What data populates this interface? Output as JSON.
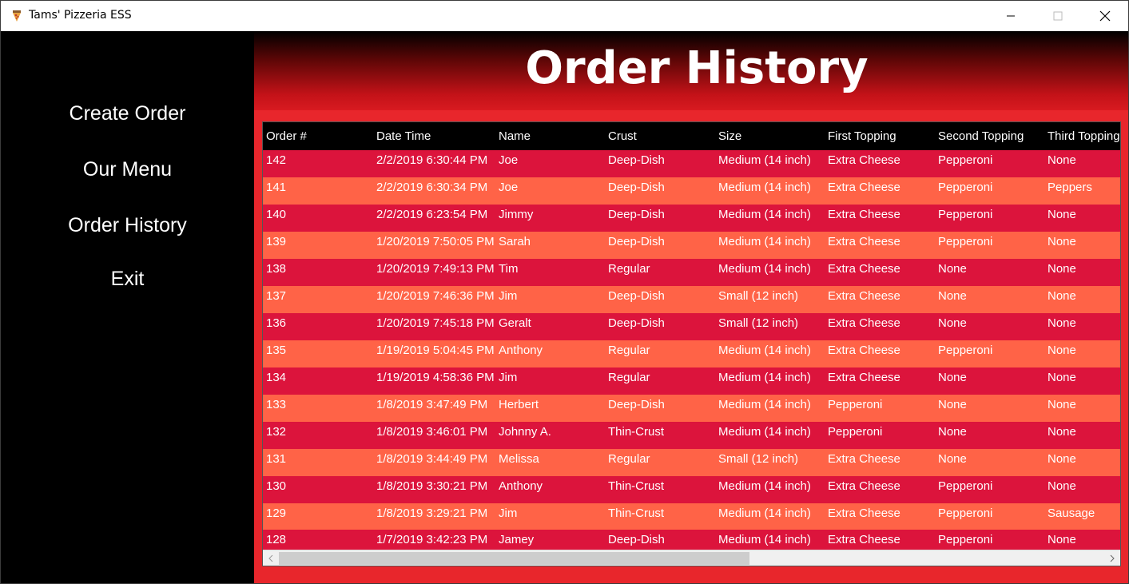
{
  "window": {
    "title": "Tams' Pizzeria ESS"
  },
  "sidebar": {
    "items": [
      {
        "label": "Create Order"
      },
      {
        "label": "Our Menu"
      },
      {
        "label": "Order History"
      },
      {
        "label": "Exit"
      }
    ]
  },
  "header": {
    "title": "Order History"
  },
  "colors": {
    "sidebar_bg": "#000000",
    "main_bg": "#e8262c",
    "row_odd": "#dc143c",
    "row_even": "#ff6347",
    "header_row_bg": "#000000"
  },
  "table": {
    "columns": [
      "Order #",
      "Date Time",
      "Name",
      "Crust",
      "Size",
      "First Topping",
      "Second Topping",
      "Third Topping"
    ],
    "rows": [
      [
        "142",
        "2/2/2019 6:30:44 PM",
        "Joe",
        "Deep-Dish",
        "Medium (14 inch)",
        "Extra Cheese",
        "Pepperoni",
        "None"
      ],
      [
        "141",
        "2/2/2019 6:30:34 PM",
        "Joe",
        "Deep-Dish",
        "Medium (14 inch)",
        "Extra Cheese",
        "Pepperoni",
        "Peppers"
      ],
      [
        "140",
        "2/2/2019 6:23:54 PM",
        "Jimmy",
        "Deep-Dish",
        "Medium (14 inch)",
        "Extra Cheese",
        "Pepperoni",
        "None"
      ],
      [
        "139",
        "1/20/2019 7:50:05 PM",
        "Sarah",
        "Deep-Dish",
        "Medium (14 inch)",
        "Extra Cheese",
        "Pepperoni",
        "None"
      ],
      [
        "138",
        "1/20/2019 7:49:13 PM",
        "Tim",
        "Regular",
        "Medium (14 inch)",
        "Extra Cheese",
        "None",
        "None"
      ],
      [
        "137",
        "1/20/2019 7:46:36 PM",
        "Jim",
        "Deep-Dish",
        "Small (12 inch)",
        "Extra Cheese",
        "None",
        "None"
      ],
      [
        "136",
        "1/20/2019 7:45:18 PM",
        "Geralt",
        "Deep-Dish",
        "Small (12 inch)",
        "Extra Cheese",
        "None",
        "None"
      ],
      [
        "135",
        "1/19/2019 5:04:45 PM",
        "Anthony",
        "Regular",
        "Medium (14 inch)",
        "Extra Cheese",
        "Pepperoni",
        "None"
      ],
      [
        "134",
        "1/19/2019 4:58:36 PM",
        "Jim",
        "Regular",
        "Medium (14 inch)",
        "Extra Cheese",
        "None",
        "None"
      ],
      [
        "133",
        "1/8/2019 3:47:49 PM",
        "Herbert",
        "Deep-Dish",
        "Medium (14 inch)",
        "Pepperoni",
        "None",
        "None"
      ],
      [
        "132",
        "1/8/2019 3:46:01 PM",
        "Johnny A.",
        "Thin-Crust",
        "Medium (14 inch)",
        "Pepperoni",
        "None",
        "None"
      ],
      [
        "131",
        "1/8/2019 3:44:49 PM",
        "Melissa",
        "Regular",
        "Small (12 inch)",
        "Extra Cheese",
        "None",
        "None"
      ],
      [
        "130",
        "1/8/2019 3:30:21 PM",
        "Anthony",
        "Thin-Crust",
        "Medium (14 inch)",
        "Extra Cheese",
        "Pepperoni",
        "None"
      ],
      [
        "129",
        "1/8/2019 3:29:21 PM",
        "Jim",
        "Thin-Crust",
        "Medium (14 inch)",
        "Extra Cheese",
        "Pepperoni",
        "Sausage"
      ],
      [
        "128",
        "1/7/2019 3:42:23 PM",
        "Jamey",
        "Deep-Dish",
        "Medium (14 inch)",
        "Extra Cheese",
        "Pepperoni",
        "None"
      ]
    ]
  },
  "scrollbar": {
    "horizontal_position": 0,
    "visible_fraction": 0.57
  }
}
